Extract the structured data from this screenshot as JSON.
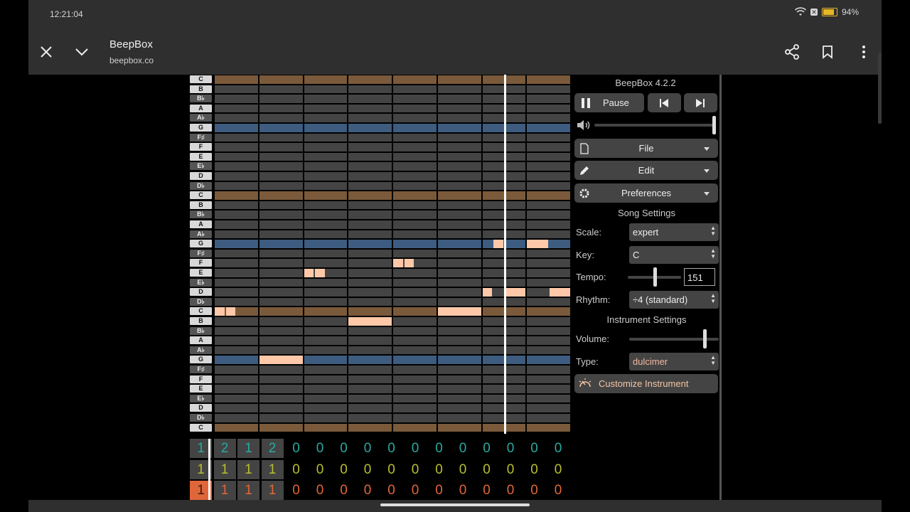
{
  "status_bar": {
    "time": "12:21:04",
    "battery": "94%",
    "battery_level": 0.94
  },
  "browser": {
    "title": "BeepBox",
    "url": "beepbox.co"
  },
  "app": {
    "version": "BeepBox 4.2.2",
    "play": {
      "pause_label": "Pause"
    },
    "volume_level": 1.0,
    "menus": {
      "file": "File",
      "edit": "Edit",
      "preferences": "Preferences"
    },
    "song_settings": {
      "heading": "Song Settings",
      "scale_label": "Scale:",
      "scale_value": "expert",
      "key_label": "Key:",
      "key_value": "C",
      "tempo_label": "Tempo:",
      "tempo_value": "151",
      "tempo_slider_level": 0.5,
      "rhythm_label": "Rhythm:",
      "rhythm_value": "÷4 (standard)"
    },
    "instrument_settings": {
      "heading": "Instrument Settings",
      "volume_label": "Volume:",
      "volume_slider_level": 0.84,
      "type_label": "Type:",
      "type_value": "dulcimer",
      "customize_label": "Customize Instrument"
    },
    "piano_keys": [
      "C",
      "B",
      "B♭",
      "A",
      "A♭",
      "G",
      "F♯",
      "F",
      "E",
      "E♭",
      "D",
      "D♭",
      "C",
      "B",
      "B♭",
      "A",
      "A♭",
      "G",
      "F♯",
      "F",
      "E",
      "E♭",
      "D",
      "D♭",
      "C",
      "B",
      "B♭",
      "A",
      "A♭",
      "G",
      "F♯",
      "F",
      "E",
      "E♭",
      "D",
      "D♭",
      "C"
    ],
    "notes": [
      {
        "pitch_row": 24,
        "bar": 0,
        "start": 0,
        "len": 0.25
      },
      {
        "pitch_row": 24,
        "bar": 0,
        "start": 0.25,
        "len": 0.25
      },
      {
        "pitch_row": 29,
        "bar": 1,
        "start": 0,
        "len": 1
      },
      {
        "pitch_row": 20,
        "bar": 2,
        "start": 0,
        "len": 0.25
      },
      {
        "pitch_row": 20,
        "bar": 2,
        "start": 0.25,
        "len": 0.25
      },
      {
        "pitch_row": 25,
        "bar": 3,
        "start": 0,
        "len": 1
      },
      {
        "pitch_row": 19,
        "bar": 4,
        "start": 0,
        "len": 0.25
      },
      {
        "pitch_row": 19,
        "bar": 4,
        "start": 0.25,
        "len": 0.25
      },
      {
        "pitch_row": 24,
        "bar": 5,
        "start": 0,
        "len": 1
      },
      {
        "pitch_row": 22,
        "bar": 6,
        "start": 0,
        "len": 0.25
      },
      {
        "pitch_row": 17,
        "bar": 6,
        "start": 0.25,
        "len": 0.25
      },
      {
        "pitch_row": 22,
        "bar": 6,
        "start": 0.5,
        "len": 0.5
      },
      {
        "pitch_row": 17,
        "bar": 7,
        "start": 0,
        "len": 0.5
      },
      {
        "pitch_row": 22,
        "bar": 7,
        "start": 0.5,
        "len": 0.5
      }
    ],
    "pattern_rows": [
      {
        "color": "#2aa9a0",
        "values": [
          "1",
          "2",
          "1",
          "2",
          "0",
          "0",
          "0",
          "0",
          "0",
          "0",
          "0",
          "0",
          "0",
          "0",
          "0",
          "0"
        ]
      },
      {
        "color": "#b9bf2e",
        "values": [
          "1",
          "1",
          "1",
          "1",
          "0",
          "0",
          "0",
          "0",
          "0",
          "0",
          "0",
          "0",
          "0",
          "0",
          "0",
          "0"
        ]
      },
      {
        "color": "#e0663a",
        "values": [
          "1",
          "1",
          "1",
          "1",
          "0",
          "0",
          "0",
          "0",
          "0",
          "0",
          "0",
          "0",
          "0",
          "0",
          "0",
          "0"
        ]
      }
    ],
    "playhead_position_bars": 6.5
  }
}
